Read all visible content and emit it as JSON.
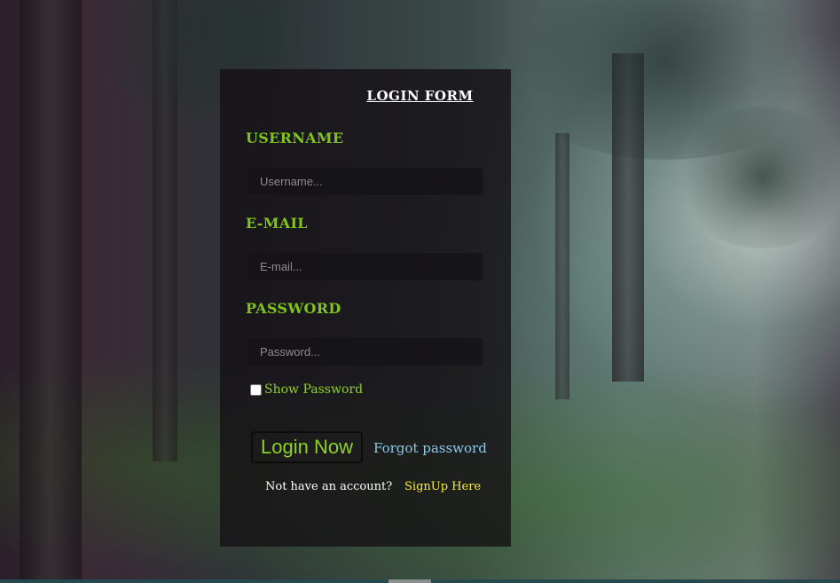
{
  "form": {
    "title": "Login Form",
    "username": {
      "label": "Username",
      "placeholder": "Username...",
      "value": ""
    },
    "email": {
      "label": "E-mail",
      "placeholder": "E-mail...",
      "value": ""
    },
    "password": {
      "label": "Password",
      "placeholder": "Password...",
      "value": ""
    },
    "show_password": {
      "label": "Show Password",
      "checked": false
    },
    "login_button": "Login Now",
    "forgot_link": "Forgot password",
    "no_account_text": "Not have an account?",
    "signup_link": "SignUp Here"
  },
  "colors": {
    "label_green": "#7fc41c",
    "link_blue": "#8ec9e8",
    "signup_yellow": "#f6ee3c",
    "panel_bg": "#141014"
  }
}
